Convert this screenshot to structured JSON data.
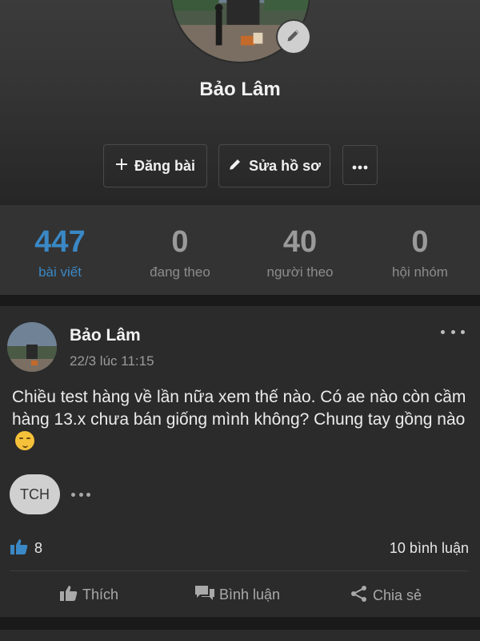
{
  "profile": {
    "name": "Bảo Lâm",
    "actions": {
      "post_label": "Đăng bài",
      "edit_label": "Sửa hồ sơ"
    }
  },
  "stats": [
    {
      "value": "447",
      "label": "bài viết",
      "active": true
    },
    {
      "value": "0",
      "label": "đang theo",
      "active": false
    },
    {
      "value": "40",
      "label": "người theo",
      "active": false
    },
    {
      "value": "0",
      "label": "hội nhóm",
      "active": false
    }
  ],
  "post": {
    "author": "Bảo Lâm",
    "time": "22/3 lúc 11:15",
    "text": "Chiều test hàng về lần nữa xem thế nào. Có ae nào còn cầm hàng 13.x chưa bán giống mình không? Chung tay gồng nào",
    "tag": "TCH",
    "like_count": "8",
    "comment_count": "10 bình luận",
    "actions": {
      "like": "Thích",
      "comment": "Bình luận",
      "share": "Chia sẻ"
    }
  },
  "colors": {
    "accent": "#3a88c5",
    "background": "#1a1a1a",
    "card": "#2b2b2b",
    "stats_bg": "#333333"
  },
  "icons": {
    "edit_avatar": "pencil-icon",
    "post": "plus-icon",
    "edit_profile": "pencil-icon",
    "more": "more-horizontal-icon",
    "like": "thumbs-up-icon",
    "comment": "comment-icon",
    "share": "share-icon",
    "emoji": "smiling-face-emoji"
  }
}
